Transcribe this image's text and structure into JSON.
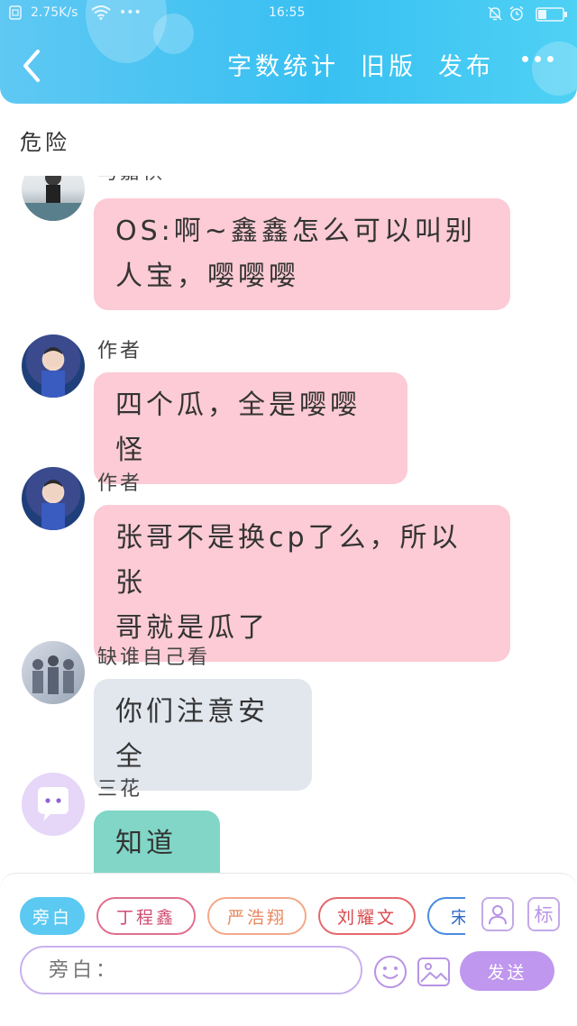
{
  "status_bar": {
    "speed": "2.75K/s",
    "dots": "•••",
    "time": "16:55"
  },
  "nav": {
    "actions": [
      "字数统计",
      "旧版",
      "发布"
    ]
  },
  "section": {
    "title": "危险"
  },
  "messages": [
    {
      "sender": "马嘉祺",
      "text_lines": [
        "OS:啊~鑫鑫怎么可以叫别",
        "人宝，嘤嘤嘤"
      ],
      "color": "#fccbd5"
    },
    {
      "sender": "作者",
      "text_lines": [
        "四个瓜，全是嘤嘤怪"
      ],
      "color": "#fccbd5"
    },
    {
      "sender": "作者",
      "text_lines": [
        "张哥不是换cp了么，所以张",
        "哥就是瓜了"
      ],
      "color": "#fccbd5"
    },
    {
      "sender": "缺谁自己看",
      "text_lines": [
        "你们注意安全"
      ],
      "color": "#e2e7ee"
    },
    {
      "sender": "三花",
      "text_lines": [
        "知道了"
      ],
      "color": "#81d6c7"
    }
  ],
  "roles": [
    "旁白",
    "丁程鑫",
    "严浩翔",
    "刘耀文",
    "宋"
  ],
  "role_colors": {
    "active": "#5bc9f1",
    "dingchengxin": "#e0708f",
    "yanhaoxiang": "#f3a98a",
    "liuyaowen": "#e5686a",
    "song": "#4a8be0"
  },
  "tools": {
    "tag_label": "标"
  },
  "composer": {
    "placeholder": "旁白：",
    "send_label": "发送"
  }
}
